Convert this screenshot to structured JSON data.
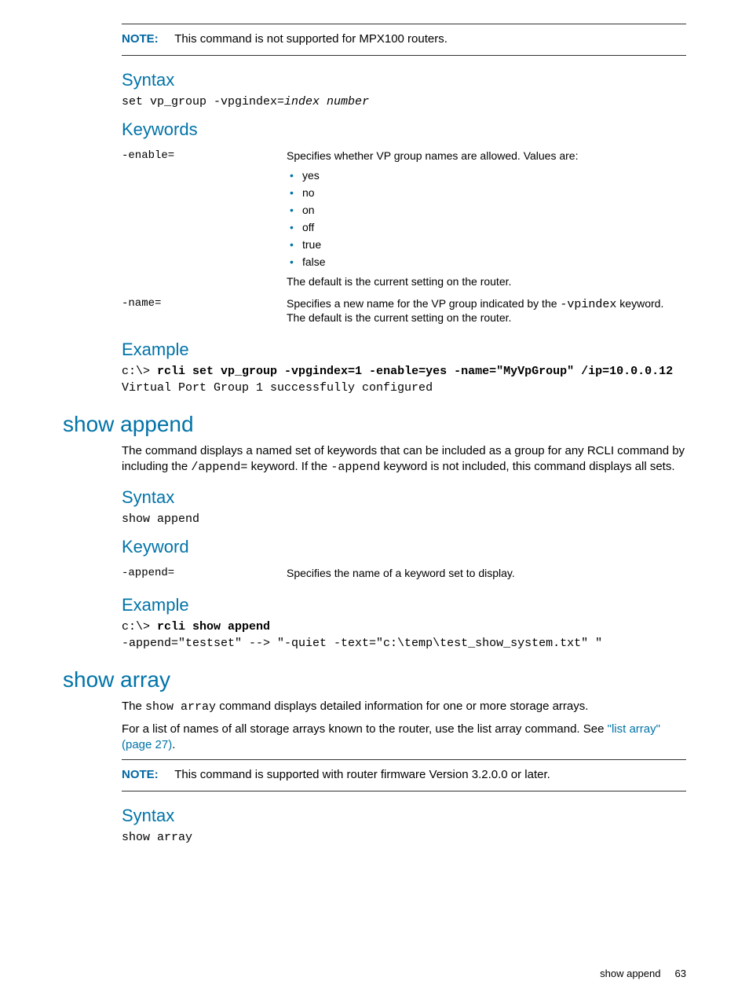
{
  "note1": {
    "label": "NOTE:",
    "text": "This command is not supported for MPX100 routers."
  },
  "sec1": {
    "syntax_h": "Syntax",
    "syntax_cmd": "set vp_group -vpgindex=",
    "syntax_arg": "index number",
    "keywords_h": "Keywords",
    "kw1_name": "-enable=",
    "kw1_desc": "Specifies whether VP group names are allowed. Values are:",
    "kw1_vals": [
      "yes",
      "no",
      "on",
      "off",
      "true",
      "false"
    ],
    "kw1_default": "The default is the current setting on the router.",
    "kw2_name": "-name=",
    "kw2_desc_a": "Specifies a new name for the VP group indicated by the ",
    "kw2_desc_code": "-vpindex",
    "kw2_desc_b": " keyword. The default is the current setting on the router.",
    "example_h": "Example",
    "ex_prompt": "c:\\> ",
    "ex_cmd": "rcli set vp_group -vpgindex=1 -enable=yes -name=\"MyVpGroup\" /ip=10.0.0.12",
    "ex_out": "Virtual Port Group 1 successfully configured"
  },
  "sec2": {
    "title": "show append",
    "desc_a": "The  command displays a named set of keywords that can be included as a group for any RCLI command by including the ",
    "desc_code1": "/append=",
    "desc_b": " keyword. If the ",
    "desc_code2": "-append",
    "desc_c": " keyword is not included, this command displays all sets.",
    "syntax_h": "Syntax",
    "syntax_cmd": "show append",
    "keyword_h": "Keyword",
    "kw_name": "-append=",
    "kw_desc": "Specifies the name of a keyword set to display.",
    "example_h": "Example",
    "ex_prompt": "c:\\> ",
    "ex_cmd": "rcli show append",
    "ex_out": "-append=\"testset\" --> \"-quiet -text=\"c:\\temp\\test_show_system.txt\" \""
  },
  "sec3": {
    "title": "show array",
    "desc_a": "The ",
    "desc_code": "show array",
    "desc_b": " command displays detailed information for one or more storage arrays.",
    "desc2_a": "For a list of names of all storage arrays known to the router, use the list array command. See ",
    "desc2_link": "\"list array\" (page 27)",
    "desc2_b": ".",
    "note_label": "NOTE:",
    "note_text": "This command is supported with router firmware Version 3.2.0.0 or later.",
    "syntax_h": "Syntax",
    "syntax_cmd": "show array"
  },
  "footer": {
    "text": "show append",
    "page": "63"
  }
}
